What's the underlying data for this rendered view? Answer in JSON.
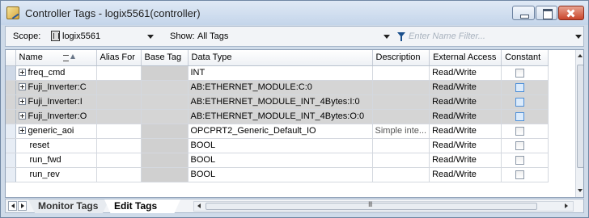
{
  "window": {
    "title": "Controller Tags - logix5561(controller)"
  },
  "toolbar": {
    "scope_label": "Scope:",
    "scope_value": "logix5561",
    "show_label": "Show:",
    "show_value": "All Tags",
    "filter_placeholder": "Enter Name Filter..."
  },
  "columns": {
    "name": "Name",
    "alias_for": "Alias For",
    "base_tag": "Base Tag",
    "data_type": "Data Type",
    "description": "Description",
    "external_access": "External Access",
    "constant": "Constant"
  },
  "rows": [
    {
      "name": "freq_cmd",
      "expandable": true,
      "alias_for": "",
      "base_tag": "",
      "data_type": "INT",
      "description": "",
      "external_access": "Read/Write",
      "constant": false
    },
    {
      "name": "Fuji_Inverter:C",
      "expandable": true,
      "alias_for": "",
      "base_tag": "",
      "data_type": "AB:ETHERNET_MODULE:C:0",
      "description": "",
      "external_access": "Read/Write",
      "constant": false
    },
    {
      "name": "Fuji_Inverter:I",
      "expandable": true,
      "alias_for": "",
      "base_tag": "",
      "data_type": "AB:ETHERNET_MODULE_INT_4Bytes:I:0",
      "description": "",
      "external_access": "Read/Write",
      "constant": false
    },
    {
      "name": "Fuji_Inverter:O",
      "expandable": true,
      "alias_for": "",
      "base_tag": "",
      "data_type": "AB:ETHERNET_MODULE_INT_4Bytes:O:0",
      "description": "",
      "external_access": "Read/Write",
      "constant": false
    },
    {
      "name": "generic_aoi",
      "expandable": true,
      "alias_for": "",
      "base_tag": "",
      "data_type": "OPCPRT2_Generic_Default_IO",
      "description": "Simple inte...",
      "external_access": "Read/Write",
      "constant": false
    },
    {
      "name": "reset",
      "expandable": false,
      "alias_for": "",
      "base_tag": "",
      "data_type": "BOOL",
      "description": "",
      "external_access": "Read/Write",
      "constant": false
    },
    {
      "name": "run_fwd",
      "expandable": false,
      "alias_for": "",
      "base_tag": "",
      "data_type": "BOOL",
      "description": "",
      "external_access": "Read/Write",
      "constant": false
    },
    {
      "name": "run_rev",
      "expandable": false,
      "alias_for": "",
      "base_tag": "",
      "data_type": "BOOL",
      "description": "",
      "external_access": "Read/Write",
      "constant": false
    }
  ],
  "tabs": {
    "monitor": "Monitor Tags",
    "edit": "Edit Tags"
  },
  "hscroll_grip": "III",
  "colors": {
    "title_bar": "#c4d5ea",
    "selected_row": "#d5d5d5",
    "close_button": "#c9452b"
  }
}
